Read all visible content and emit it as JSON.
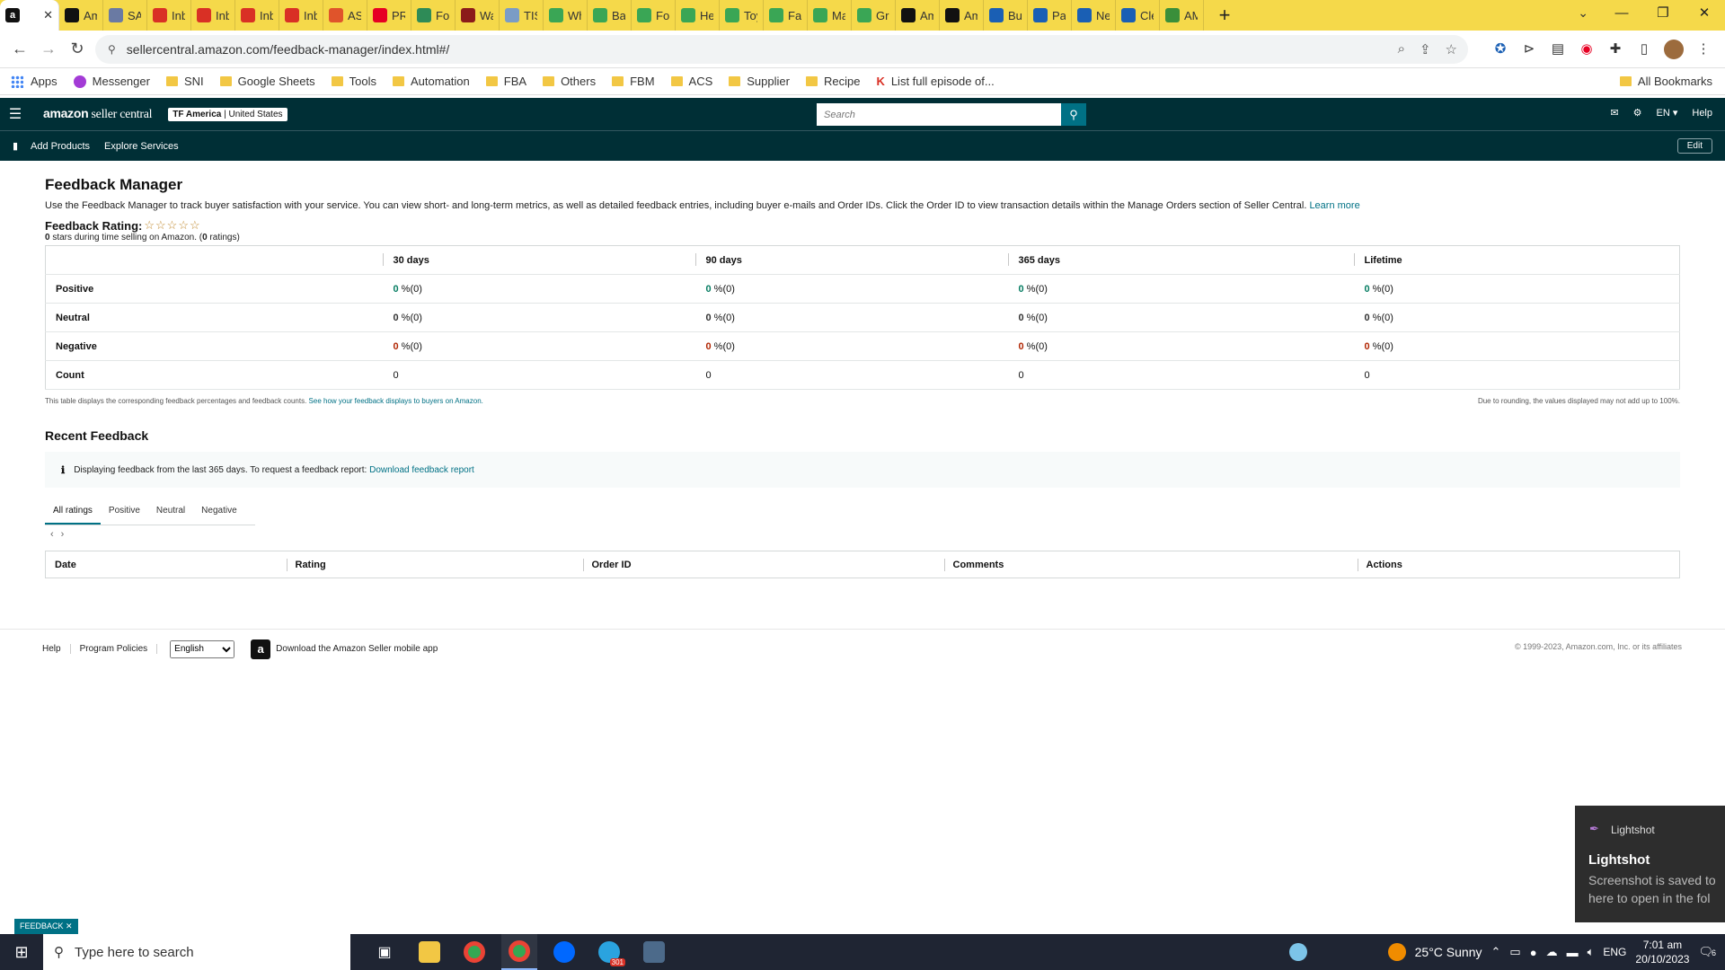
{
  "browser": {
    "active_tab_favicon": "a",
    "tabs": [
      {
        "label": "Am",
        "icon": "amazon-icon",
        "color": "#111111"
      },
      {
        "label": "SAS",
        "icon": "sas-icon",
        "color": "#6a7aa3"
      },
      {
        "label": "Inb",
        "icon": "gmail-icon",
        "color": "#d93025"
      },
      {
        "label": "Inb",
        "icon": "gmail-icon",
        "color": "#d93025"
      },
      {
        "label": "Inb",
        "icon": "gmail-icon",
        "color": "#d93025"
      },
      {
        "label": "Inb",
        "icon": "gmail-icon",
        "color": "#d93025"
      },
      {
        "label": "ASI",
        "icon": "asin-icon",
        "color": "#e0542b"
      },
      {
        "label": "PRI",
        "icon": "pinterest-icon",
        "color": "#e60023"
      },
      {
        "label": "Foo",
        "icon": "leaf-icon",
        "color": "#2e8b57"
      },
      {
        "label": "Wa",
        "icon": "w-icon",
        "color": "#8b1a1a"
      },
      {
        "label": "TIS",
        "icon": "doc-icon",
        "color": "#7a9cc6"
      },
      {
        "label": "Wh",
        "icon": "leaf-icon",
        "color": "#3aa655"
      },
      {
        "label": "Bat",
        "icon": "leaf-icon",
        "color": "#3aa655"
      },
      {
        "label": "Foo",
        "icon": "leaf-icon",
        "color": "#3aa655"
      },
      {
        "label": "Hea",
        "icon": "leaf-icon",
        "color": "#3aa655"
      },
      {
        "label": "Toy",
        "icon": "leaf-icon",
        "color": "#3aa655"
      },
      {
        "label": "Fac",
        "icon": "leaf-icon",
        "color": "#3aa655"
      },
      {
        "label": "Ma",
        "icon": "leaf-icon",
        "color": "#3aa655"
      },
      {
        "label": "Gro",
        "icon": "leaf-icon",
        "color": "#3aa655"
      },
      {
        "label": "Am",
        "icon": "amazon-icon",
        "color": "#111111"
      },
      {
        "label": "Am",
        "icon": "amazon-icon",
        "color": "#111111"
      },
      {
        "label": "Buy",
        "icon": "box-icon",
        "color": "#1a5fb4"
      },
      {
        "label": "Par",
        "icon": "box-icon",
        "color": "#1a5fb4"
      },
      {
        "label": "Nev",
        "icon": "box-icon",
        "color": "#1a5fb4"
      },
      {
        "label": "Cle",
        "icon": "box-icon",
        "color": "#1a5fb4"
      },
      {
        "label": "AM",
        "icon": "pen-icon",
        "color": "#3a8f3a"
      }
    ],
    "url": "sellercentral.amazon.com/feedback-manager/index.html#/",
    "bookmarks": [
      {
        "label": "Apps",
        "type": "apps"
      },
      {
        "label": "Messenger",
        "type": "messenger"
      },
      {
        "label": "SNI",
        "type": "folder"
      },
      {
        "label": "Google Sheets",
        "type": "folder"
      },
      {
        "label": "Tools",
        "type": "folder"
      },
      {
        "label": "Automation",
        "type": "folder"
      },
      {
        "label": "FBA",
        "type": "folder"
      },
      {
        "label": "Others",
        "type": "folder"
      },
      {
        "label": "FBM",
        "type": "folder"
      },
      {
        "label": "ACS",
        "type": "folder"
      },
      {
        "label": "Supplier",
        "type": "folder"
      },
      {
        "label": "Recipe",
        "type": "folder"
      },
      {
        "label": "List full episode of...",
        "type": "k"
      }
    ],
    "all_bookmarks": "All Bookmarks"
  },
  "header": {
    "logo_bold": "amazon",
    "logo_light": " seller central",
    "store_bold": "TF America",
    "store_rest": " | United States",
    "search_placeholder": "Search",
    "lang": "EN",
    "help": "Help"
  },
  "subnav": {
    "links": [
      "Add Products",
      "Explore Services"
    ],
    "edit": "Edit"
  },
  "page": {
    "title": "Feedback Manager",
    "intro": "Use the Feedback Manager to track buyer satisfaction with your service. You can view short- and long-term metrics, as well as detailed feedback entries, including buyer e-mails and Order IDs. Click the Order ID to view transaction details within the Manage Orders section of Seller Central.",
    "learn_more": "Learn more",
    "rating_label": "Feedback Rating:",
    "stars": "☆☆☆☆☆",
    "rating_count_bold": "0",
    "rating_sub_mid": " stars during time selling on Amazon. (",
    "rating_sub_bold": "0",
    "rating_sub_end": " ratings)"
  },
  "metrics_table": {
    "columns": [
      "30 days",
      "90 days",
      "365 days",
      "Lifetime"
    ],
    "rows": [
      {
        "label": "Positive",
        "cells": [
          [
            "0",
            " %(0)"
          ],
          [
            "0",
            " %(0)"
          ],
          [
            "0",
            " %(0)"
          ],
          [
            "0",
            " %(0)"
          ]
        ]
      },
      {
        "label": "Neutral",
        "cells": [
          [
            "0",
            " %(0)"
          ],
          [
            "0",
            " %(0)"
          ],
          [
            "0",
            " %(0)"
          ],
          [
            "0",
            " %(0)"
          ]
        ]
      },
      {
        "label": "Negative",
        "cells": [
          [
            "0",
            " %(0)"
          ],
          [
            "0",
            " %(0)"
          ],
          [
            "0",
            " %(0)"
          ],
          [
            "0",
            " %(0)"
          ]
        ]
      },
      {
        "label": "Count",
        "cells": [
          [
            "",
            "0"
          ],
          [
            "",
            "0"
          ],
          [
            "",
            "0"
          ],
          [
            "",
            "0"
          ]
        ]
      }
    ],
    "note_left": "This table displays the corresponding feedback percentages and feedback counts.",
    "note_link": "See how your feedback displays to buyers on Amazon.",
    "note_right": "Due to rounding, the values displayed may not add up to 100%."
  },
  "recent": {
    "title": "Recent Feedback",
    "info_text": "Displaying feedback from the last 365 days. To request a feedback report:",
    "info_link": "Download feedback report",
    "tabs": [
      "All ratings",
      "Positive",
      "Neutral",
      "Negative"
    ],
    "active_tab": "All ratings",
    "columns": [
      "Date",
      "Rating",
      "Order ID",
      "Comments",
      "Actions"
    ]
  },
  "footer": {
    "help": "Help",
    "policies": "Program Policies",
    "language": "English",
    "app_text": "Download the Amazon Seller mobile app",
    "copyright": "© 1999-2023, Amazon.com, Inc. or its affiliates"
  },
  "toast": {
    "app": "Lightshot",
    "title": "Lightshot",
    "line1": "Screenshot is saved to",
    "line2": "here to open in the fol"
  },
  "feedback_tag": "FEEDBACK",
  "taskbar": {
    "search_placeholder": "Type here to search",
    "weather": "25°C  Sunny",
    "lang": "ENG",
    "time": "7:01 am",
    "date": "20/10/2023",
    "telegram_badge": "301",
    "notif_count": "6"
  }
}
